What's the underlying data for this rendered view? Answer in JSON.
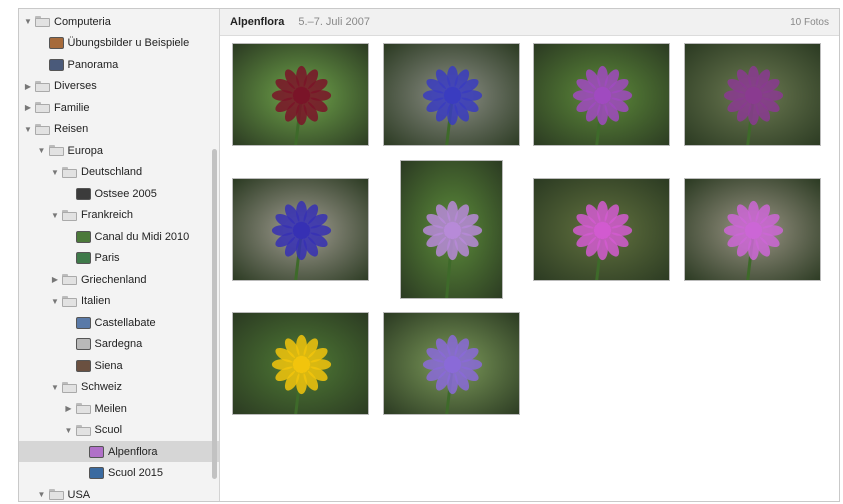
{
  "sidebar": {
    "items": [
      {
        "label": "Computeria",
        "level": 0,
        "type": "folder",
        "arrow": "▼",
        "color": "#e2e2e2"
      },
      {
        "label": "Übungsbilder u Beispiele",
        "level": 1,
        "type": "album",
        "arrow": "",
        "color": "#a66a3a"
      },
      {
        "label": "Panorama",
        "level": 1,
        "type": "album",
        "arrow": "",
        "color": "#4a5a7a"
      },
      {
        "label": "Diverses",
        "level": 0,
        "type": "folder",
        "arrow": "▶",
        "color": "#e2e2e2"
      },
      {
        "label": "Familie",
        "level": 0,
        "type": "folder",
        "arrow": "▶",
        "color": "#e2e2e2"
      },
      {
        "label": "Reisen",
        "level": 0,
        "type": "folder",
        "arrow": "▼",
        "color": "#e2e2e2"
      },
      {
        "label": "Europa",
        "level": 1,
        "type": "folder",
        "arrow": "▼",
        "color": "#e2e2e2"
      },
      {
        "label": "Deutschland",
        "level": 2,
        "type": "folder",
        "arrow": "▼",
        "color": "#e2e2e2"
      },
      {
        "label": "Ostsee 2005",
        "level": 3,
        "type": "album",
        "arrow": "",
        "color": "#3b3b3b"
      },
      {
        "label": "Frankreich",
        "level": 2,
        "type": "folder",
        "arrow": "▼",
        "color": "#e2e2e2"
      },
      {
        "label": "Canal du Midi 2010",
        "level": 3,
        "type": "album",
        "arrow": "",
        "color": "#4c7a3a"
      },
      {
        "label": "Paris",
        "level": 3,
        "type": "album",
        "arrow": "",
        "color": "#3f7a4a"
      },
      {
        "label": "Griechenland",
        "level": 2,
        "type": "folder",
        "arrow": "▶",
        "color": "#e2e2e2"
      },
      {
        "label": "Italien",
        "level": 2,
        "type": "folder",
        "arrow": "▼",
        "color": "#e2e2e2"
      },
      {
        "label": "Castellabate",
        "level": 3,
        "type": "album",
        "arrow": "",
        "color": "#5a7aa8"
      },
      {
        "label": "Sardegna",
        "level": 3,
        "type": "album",
        "arrow": "",
        "color": "#b9b9b9"
      },
      {
        "label": "Siena",
        "level": 3,
        "type": "album",
        "arrow": "",
        "color": "#6a5040"
      },
      {
        "label": "Schweiz",
        "level": 2,
        "type": "folder",
        "arrow": "▼",
        "color": "#e2e2e2"
      },
      {
        "label": "Meilen",
        "level": 3,
        "type": "folder",
        "arrow": "▶",
        "color": "#e2e2e2"
      },
      {
        "label": "Scuol",
        "level": 3,
        "type": "folder",
        "arrow": "▼",
        "color": "#e2e2e2"
      },
      {
        "label": "Alpenflora",
        "level": 4,
        "type": "album",
        "arrow": "",
        "color": "#b070c8",
        "selected": true
      },
      {
        "label": "Scuol 2015",
        "level": 4,
        "type": "album",
        "arrow": "",
        "color": "#3a6aa0"
      },
      {
        "label": "USA",
        "level": 1,
        "type": "folder",
        "arrow": "▼",
        "color": "#e2e2e2"
      }
    ]
  },
  "header": {
    "title": "Alpenflora",
    "date": "5.–7. Juli 2007",
    "count": "10 Fotos"
  },
  "photos": [
    {
      "name": "photo-dark-red-orchid",
      "bg": "#6fa34a",
      "flower": "#7a1428"
    },
    {
      "name": "photo-blue-rampion-rock",
      "bg": "#8c8f86",
      "flower": "#3a3cc0"
    },
    {
      "name": "photo-purple-thistle",
      "bg": "#5d8a3a",
      "flower": "#a04ac0"
    },
    {
      "name": "photo-woolly-thistle",
      "bg": "#6c7a52",
      "flower": "#8a3a90"
    },
    {
      "name": "photo-blue-rampion-closeup",
      "bg": "#a19d92",
      "flower": "#3630b4"
    },
    {
      "name": "photo-lilac-orchid",
      "bg": "#5c8c3a",
      "flower": "#b78ad8"
    },
    {
      "name": "photo-pink-thistle-bee",
      "bg": "#62723f",
      "flower": "#d25ad0"
    },
    {
      "name": "photo-thistle-butterfly",
      "bg": "#9a9585",
      "flower": "#cc66d6"
    },
    {
      "name": "photo-yellow-flower",
      "bg": "#4f7a35",
      "flower": "#f2c40c"
    },
    {
      "name": "photo-violet-bellflower",
      "bg": "#7c9a5a",
      "flower": "#8a6ad8"
    }
  ]
}
